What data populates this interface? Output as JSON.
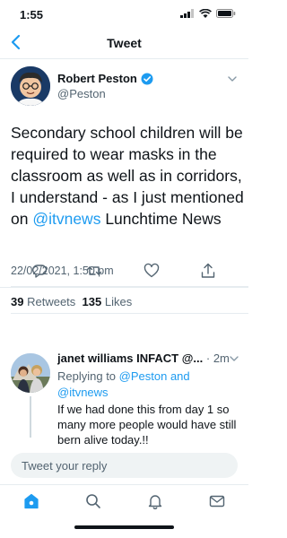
{
  "status_bar": {
    "time": "1:55"
  },
  "nav": {
    "title": "Tweet"
  },
  "tweet": {
    "author_name": "Robert Peston",
    "author_handle": "@Peston",
    "verified": true,
    "text_part1": "Secondary school children will be required to wear masks in the classroom as well as in corridors, I understand - as I just mentioned on ",
    "text_link": "@itvnews",
    "text_part2": " Lunchtime News",
    "timestamp": "22/02/2021, 1:50 pm",
    "retweets_count": "39",
    "retweets_label": "Retweets",
    "likes_count": "135",
    "likes_label": "Likes"
  },
  "reply": {
    "author_name": "janet williams",
    "author_suffix": "INFACT @...",
    "age": "· 2m",
    "replying_prefix": "Replying to ",
    "replying_user1": "@Peston",
    "replying_and": " and",
    "replying_user2": "@itvnews",
    "text": "If we had done this from day 1 so many more people would have still bern alive today.!!"
  },
  "reply_input": {
    "placeholder": "Tweet your reply"
  },
  "colors": {
    "accent": "#1d9bf0",
    "text": "#0f1419",
    "secondary": "#536471"
  },
  "icons": {
    "back": "chevron-left-icon",
    "verified": "verified-badge-icon",
    "more": "chevron-down-icon",
    "reply": "reply-icon",
    "retweet": "retweet-icon",
    "like": "heart-icon",
    "share": "share-icon",
    "home": "home-icon",
    "search": "search-icon",
    "notifications": "bell-icon",
    "messages": "mail-icon"
  }
}
